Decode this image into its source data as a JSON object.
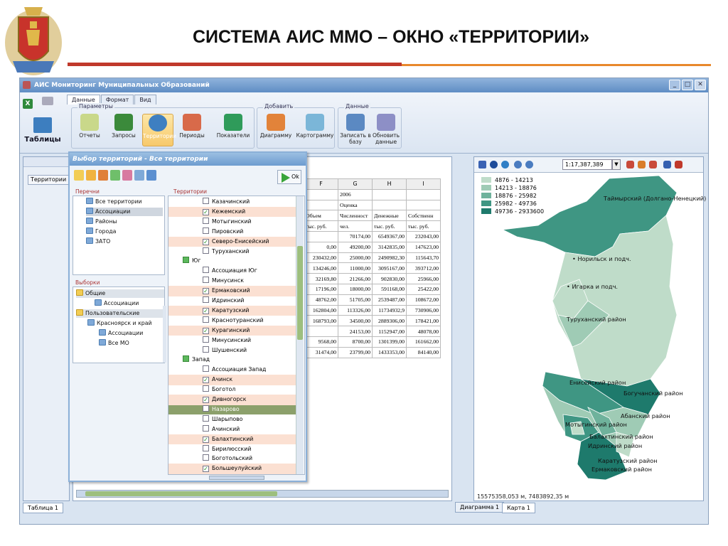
{
  "slide": {
    "title": "СИСТЕМА АИС ММО – ОКНО «ТЕРРИТОРИИ»"
  },
  "window": {
    "title": "АИС Мониторинг Муниципальных Образований",
    "min": "_",
    "max": "□",
    "close": "✕"
  },
  "ribbon": {
    "tabs": [
      "Данные",
      "Формат",
      "Вид"
    ],
    "big_button": "Таблицы",
    "groups": {
      "params": "Параметры",
      "add": "Добавить",
      "data": "Данные"
    },
    "buttons": {
      "reports": "Отчеты",
      "queries": "Запросы",
      "territories": "Территории",
      "periods": "Периоды",
      "indicators": "Показатели",
      "diagram": "Диаграмму",
      "cartogram": "Картограмму",
      "write_db": "Записать в базу",
      "refresh": "Обновить данные"
    }
  },
  "left_panel": {
    "label": "Территории",
    "bottom_tab": "Таблица 1"
  },
  "table": {
    "col_headers": [
      "F",
      "G",
      "H",
      "I"
    ],
    "year": "2006",
    "mode": "Оценка",
    "headers": [
      "Объем",
      "Численност",
      "Денежные",
      "Собственн"
    ],
    "units": [
      "тыс. руб.",
      "чел.",
      "тыс. руб.",
      "тыс. руб."
    ],
    "rows": [
      [
        "",
        "70174,00",
        "6549367,00",
        "232043,00"
      ],
      [
        "0,00",
        "49200,00",
        "3142835,00",
        "147623,00"
      ],
      [
        "230432,00",
        "25000,00",
        "2490982,30",
        "115643,70"
      ],
      [
        "134246,00",
        "11000,00",
        "3095167,00",
        "393712,00"
      ],
      [
        "32169,80",
        "21266,00",
        "902830,00",
        "25966,00"
      ],
      [
        "17196,00",
        "18000,00",
        "591168,00",
        "25422,00"
      ],
      [
        "48762,00",
        "51705,00",
        "2539487,00",
        "108672,00"
      ],
      [
        "162804,00",
        "113326,00",
        "11734932,9",
        "730906,00"
      ],
      [
        "168793,00",
        "34500,00",
        "2889306,00",
        "178421,00"
      ],
      [
        "",
        "24153,00",
        "1152947,00",
        "48078,00"
      ],
      [
        "9568,00",
        "8700,00",
        "1301399,00",
        "161662,00"
      ],
      [
        "31474,00",
        "23799,00",
        "1433353,00",
        "84140,00"
      ]
    ]
  },
  "dialog": {
    "title": "Выбор территорий - Все территории",
    "ok": "Ok",
    "lists_label": "Перечни",
    "lists": [
      "Все территории",
      "Ассоциации",
      "Районы",
      "Города",
      "ЗАТО"
    ],
    "samples_label": "Выборки",
    "samples": [
      "Общие",
      "Ассоциации",
      "Пользовательские",
      "Красноярск и край",
      "Ассоциации",
      "Все МО"
    ],
    "terr_label": "Территории",
    "territories": [
      "Казачинский",
      "Кежемский",
      "Мотыгинский",
      "Пировский",
      "Северо-Енисейский",
      "Туруханский",
      "Юг",
      "Ассоциация Юг",
      "Минусинск",
      "Ермаковский",
      "Идринский",
      "Каратузский",
      "Краснотуранский",
      "Курагинский",
      "Минусинский",
      "Шушенский",
      "Запад",
      "Ассоциация Запад",
      "Ачинск",
      "Боготол",
      "Дивногорск",
      "Назарово",
      "Шарыпово",
      "Ачинский",
      "Балахтинский",
      "Бирилюсский",
      "Боготольский",
      "Большеулуйский"
    ],
    "checked": [
      false,
      true,
      false,
      false,
      true,
      false,
      true,
      false,
      false,
      true,
      false,
      true,
      false,
      true,
      false,
      false,
      true,
      false,
      true,
      false,
      true,
      false,
      false,
      false,
      true,
      false,
      false,
      true
    ],
    "groups": [
      false,
      false,
      false,
      false,
      false,
      false,
      true,
      false,
      false,
      false,
      false,
      false,
      false,
      false,
      false,
      false,
      true,
      false,
      false,
      false,
      false,
      false,
      false,
      false,
      false,
      false,
      false,
      false
    ],
    "alt": [
      false,
      true,
      false,
      false,
      true,
      false,
      false,
      false,
      false,
      true,
      false,
      true,
      false,
      true,
      false,
      false,
      false,
      false,
      true,
      false,
      true,
      false,
      false,
      false,
      true,
      false,
      false,
      true
    ],
    "selected_index": 21
  },
  "map": {
    "scale": "1:17,387,389",
    "legend": [
      {
        "range": "4876 - 14213",
        "color": "#bfdcc9"
      },
      {
        "range": "14213 - 18876",
        "color": "#9fcbb5"
      },
      {
        "range": "18876 - 25982",
        "color": "#6fb29c"
      },
      {
        "range": "25982 - 49736",
        "color": "#3f9683"
      },
      {
        "range": "49736 - 2933600",
        "color": "#1e7a6c"
      }
    ],
    "labels": [
      "Таймырский (Долгано-Ненецкий) ра",
      "Норильск и подч.",
      "Игарка и подч.",
      "Туруханский район",
      "Енисейский район",
      "Богучанский район",
      "Абанский район",
      "Мотыгинский район",
      "Балахтинский район",
      "Идринский район",
      "Каратузский район",
      "Ермаковский район"
    ],
    "status": "15575358,053 м,   7483892,35 м",
    "tabs": [
      "Диаграмма 1",
      "Карта 1"
    ]
  }
}
